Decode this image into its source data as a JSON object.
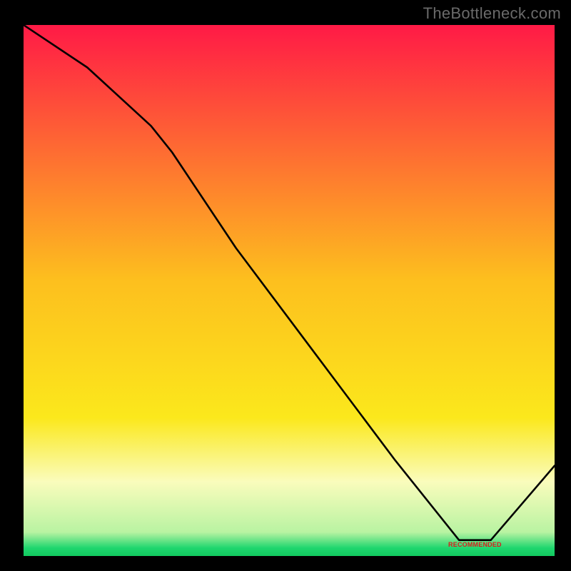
{
  "watermark": "TheBottleneck.com",
  "chart_data": {
    "type": "line",
    "title": "",
    "xlabel": "",
    "ylabel": "",
    "xlim": [
      0,
      100
    ],
    "ylim": [
      0,
      100
    ],
    "grid": false,
    "legend": false,
    "background_gradient": {
      "stops": [
        {
          "offset": 0.0,
          "color": "#ff1a46"
        },
        {
          "offset": 0.48,
          "color": "#fdbf1e"
        },
        {
          "offset": 0.74,
          "color": "#fbe81c"
        },
        {
          "offset": 0.86,
          "color": "#fafcbc"
        },
        {
          "offset": 0.955,
          "color": "#b9f3a2"
        },
        {
          "offset": 0.985,
          "color": "#1ed66e"
        },
        {
          "offset": 1.0,
          "color": "#12c95f"
        }
      ]
    },
    "series": [
      {
        "name": "curve",
        "color": "#000000",
        "x": [
          0,
          12,
          24,
          28,
          40,
          55,
          70,
          82,
          88,
          100
        ],
        "y": [
          100,
          92,
          81,
          76,
          58,
          38,
          18,
          3,
          3,
          17
        ]
      }
    ],
    "annotations": [
      {
        "text": "RECOMMENDED",
        "x": 85,
        "y": 2.2
      }
    ]
  }
}
